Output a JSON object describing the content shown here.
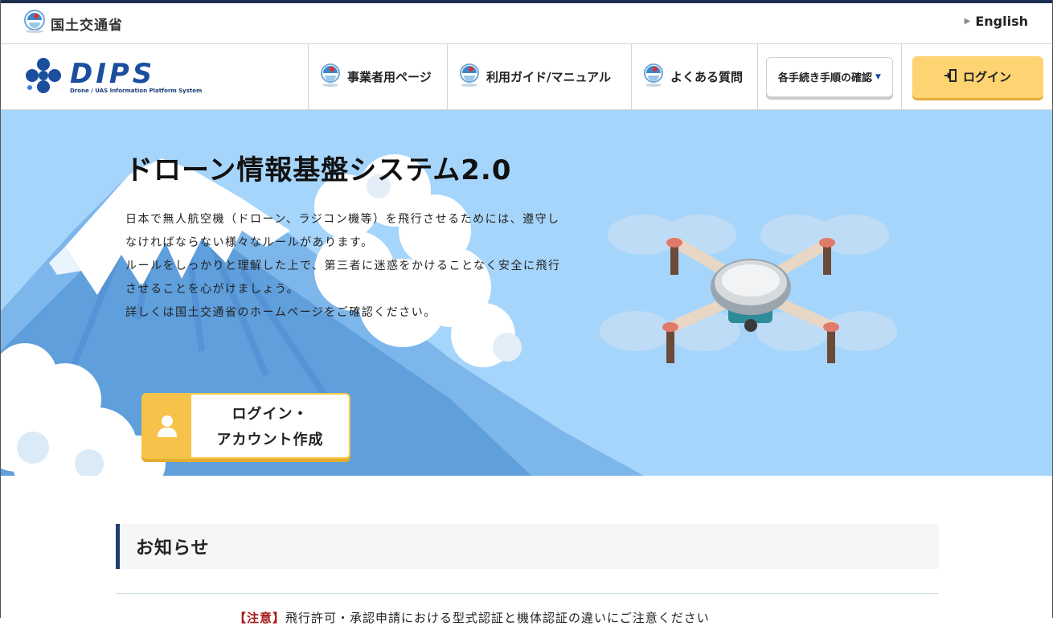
{
  "site": {
    "ministry_name": "国土交通省",
    "english_link": "English"
  },
  "logo": {
    "word": "DIPS",
    "subtitle": "Drone / UAS Information Platform System"
  },
  "nav": {
    "items": [
      {
        "label": "事業者用ページ",
        "icon": "mlit-emblem-icon"
      },
      {
        "label": "利用ガイド/マニュアル",
        "icon": "mlit-emblem-icon"
      },
      {
        "label": "よくある質問",
        "icon": "mlit-emblem-icon"
      }
    ],
    "dropdown_label": "各手続き手順の確認",
    "login_label": "ログイン"
  },
  "hero": {
    "title": "ドローン情報基盤システム2.0",
    "lines": [
      "日本で無人航空機（ドローン、ラジコン機等）を飛行させるためには、遵守し",
      "なければならない様々なルールがあります。",
      "ルールをしっかりと理解した上で、第三者に迷惑をかけることなく安全に飛行",
      "させることを心がけましょう。",
      "詳しくは国土交通省のホームページをご確認ください。"
    ],
    "cta_line1": "ログイン・",
    "cta_line2": "アカウント作成"
  },
  "news": {
    "heading": "お知らせ",
    "first_item_tag": "【注意】",
    "first_item_text": "飛行許可・承認申請における型式認証と機体認証の違いにご注意ください"
  },
  "colors": {
    "brand_navy": "#1b2f4e",
    "accent_yellow": "#fed371",
    "hero_sky": "#a6d5fb",
    "logo_blue": "#1b4f9e"
  }
}
